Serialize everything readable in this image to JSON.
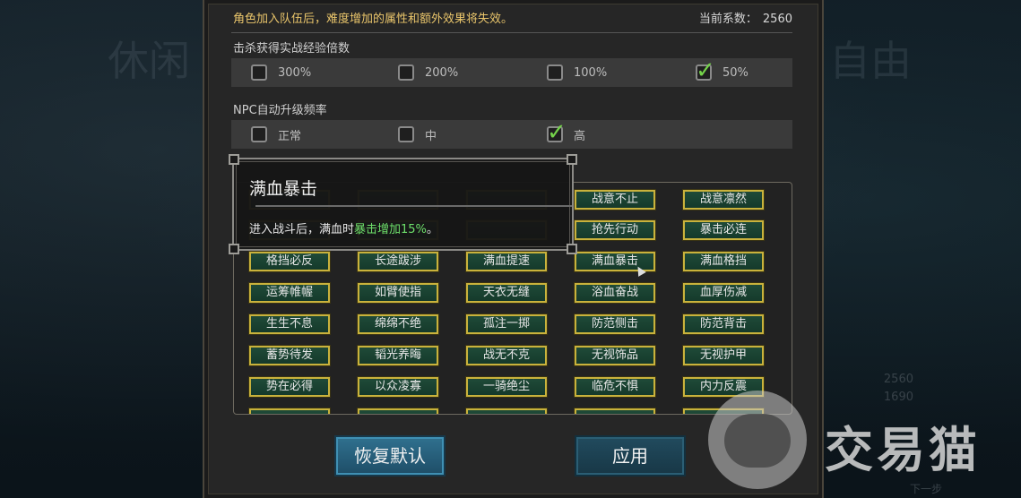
{
  "background": {
    "callig_left": "休闲",
    "callig_right": "自由",
    "stats": [
      "2560",
      "1690"
    ],
    "next_label": "下一步"
  },
  "header": {
    "warning": "角色加入队伍后，难度增加的属性和额外效果将失效。",
    "coef_label": "当前系数：",
    "coef_value": "2560"
  },
  "exp_section": {
    "title": "击杀获得实战经验倍数",
    "options": [
      {
        "label": "300%",
        "checked": false
      },
      {
        "label": "200%",
        "checked": false
      },
      {
        "label": "100%",
        "checked": false
      },
      {
        "label": "50%",
        "checked": true
      }
    ]
  },
  "npc_section": {
    "title": "NPC自动升级频率",
    "options": [
      {
        "label": "正常",
        "checked": false
      },
      {
        "label": "中",
        "checked": false
      },
      {
        "label": "高",
        "checked": true
      }
    ]
  },
  "traits": [
    [
      "",
      "",
      "",
      "战意不止",
      "战意凛然"
    ],
    [
      "",
      "",
      "",
      "抢先行动",
      "暴击必连"
    ],
    [
      "格挡必反",
      "长途跋涉",
      "满血提速",
      "满血暴击",
      "满血格挡"
    ],
    [
      "运筹帷幄",
      "如臂使指",
      "天衣无缝",
      "浴血奋战",
      "血厚伤减"
    ],
    [
      "生生不息",
      "绵绵不绝",
      "孤注一掷",
      "防范侧击",
      "防范背击"
    ],
    [
      "蓄势待发",
      "韬光养晦",
      "战无不克",
      "无视饰品",
      "无视护甲"
    ],
    [
      "势在必得",
      "以众凌寡",
      "一骑绝尘",
      "临危不惧",
      "内力反震"
    ],
    [
      "",
      "",
      "",
      "",
      ""
    ]
  ],
  "tooltip": {
    "title": "满血暴击",
    "desc_prefix": "进入战斗后，满血时",
    "desc_highlight": "暴击增加15%",
    "desc_suffix": "。"
  },
  "buttons": {
    "reset": "恢复默认",
    "apply": "应用"
  },
  "watermark": {
    "text": "交易猫"
  },
  "colors": {
    "warning": "#e9c56b",
    "highlight": "#6ee06a",
    "trait_border": "#c9b23c",
    "trait_fill": "#1f4a38"
  }
}
